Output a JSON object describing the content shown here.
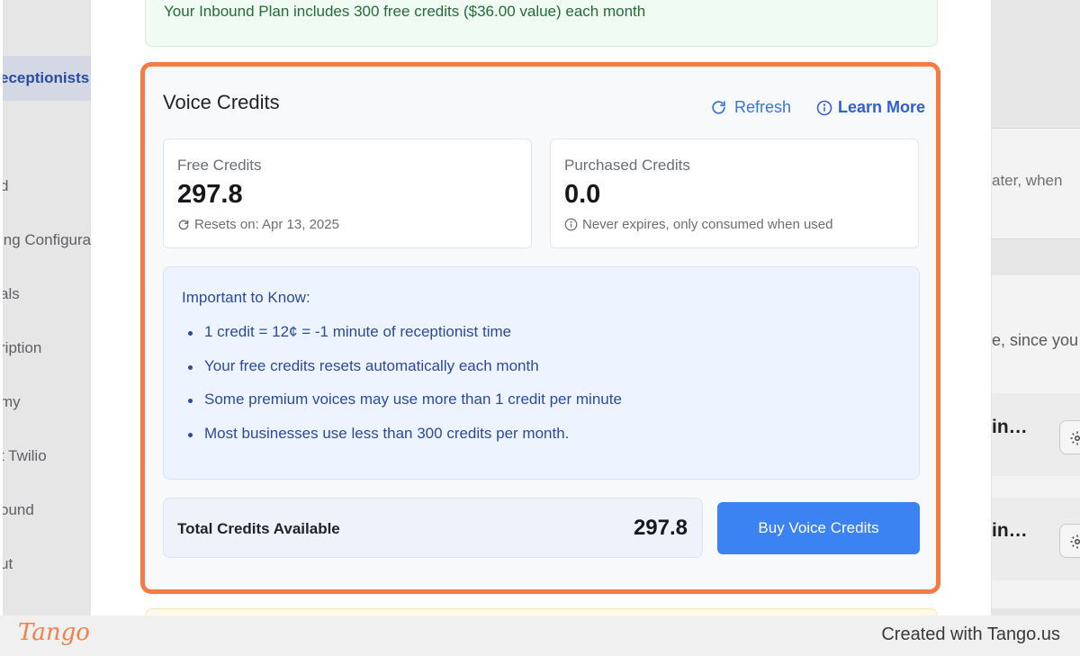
{
  "background": {
    "nav_items": [
      {
        "label": "eceptionists",
        "active": true
      },
      {
        "label": "d"
      },
      {
        "label": "ing Configura"
      },
      {
        "label": "als"
      },
      {
        "label": "ription"
      },
      {
        "label": "my"
      },
      {
        "label": "t Twilio"
      },
      {
        "label": "ound"
      },
      {
        "label": "ut"
      }
    ],
    "right_text_1": "ater, when",
    "right_text_2": "e, since you",
    "right_title_1": "in…",
    "right_title_2": "in…"
  },
  "modal": {
    "plan_banner": "Your Inbound Plan includes 300 free credits ($36.00 value) each month",
    "card": {
      "title": "Voice Credits",
      "refresh_label": "Refresh",
      "learn_more_label": "Learn More",
      "free": {
        "label": "Free Credits",
        "value": "297.8",
        "note": "Resets on: Apr 13, 2025"
      },
      "purchased": {
        "label": "Purchased Credits",
        "value": "0.0",
        "note": "Never expires, only consumed when used"
      },
      "info": {
        "title": "Important to Know:",
        "items": [
          "1 credit = 12¢ = -1 minute of receptionist time",
          "Your free credits resets automatically each month",
          "Some premium voices may use more than 1 credit per minute",
          "Most businesses use less than 300 credits per month."
        ]
      },
      "total": {
        "label": "Total Credits Available",
        "value": "297.8"
      },
      "buy_label": "Buy Voice Credits"
    }
  },
  "footer": {
    "logo": "Tango",
    "credit": "Created with Tango.us"
  },
  "colors": {
    "accent_blue": "#3b82f2",
    "highlight_orange": "#f77a45",
    "info_text": "#2b4a9e",
    "banner_green": "#246b38"
  },
  "icons": [
    "refresh-icon",
    "info-icon",
    "reset-icon",
    "gear-icon"
  ]
}
